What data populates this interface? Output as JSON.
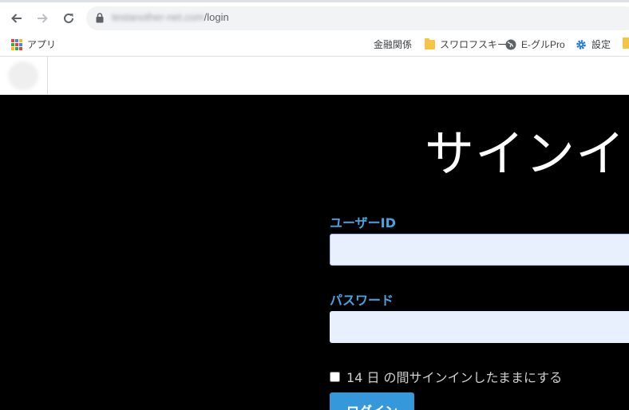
{
  "browser": {
    "url_host": "testanother-net.com",
    "url_path": "/login"
  },
  "bookmarks": {
    "apps_label": "アプリ",
    "items": [
      {
        "label": "金融関係",
        "icon": "none"
      },
      {
        "label": "スワロフスキー",
        "icon": "folder-icon"
      },
      {
        "label": "E-グルPro",
        "icon": "globe-icon"
      },
      {
        "label": "設定",
        "icon": "gear-icon"
      }
    ]
  },
  "login": {
    "title": "サインイン",
    "userid_label": "ユーザーID",
    "userid_value": "",
    "password_label": "パスワード",
    "password_value": "",
    "remember_label": "14 日 の間サインインしたままにする",
    "login_button": "ログイン"
  },
  "colors": {
    "accent": "#3498db",
    "label": "#4aa3df",
    "input_bg": "#e8f0fe",
    "page_bg": "#000000"
  }
}
